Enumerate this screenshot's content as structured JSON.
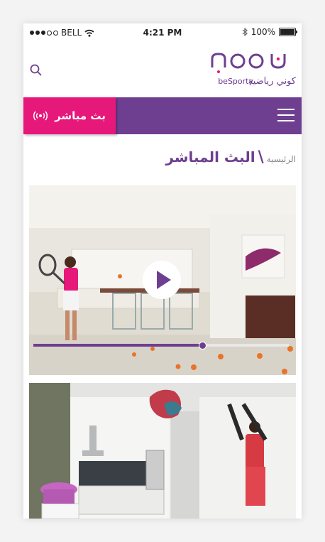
{
  "status_bar": {
    "carrier": "BELL",
    "time": "4:21 PM",
    "battery": "100%",
    "battery_level": 1.0,
    "signal_bars_filled": 3,
    "signal_bars_total": 5
  },
  "header": {
    "logo_text_ar": "كوني رياضية",
    "logo_text_en": "beSporty"
  },
  "navbar": {
    "live_label": "بث مباشر",
    "colors": {
      "primary": "#6e3f91",
      "accent": "#e6197a"
    }
  },
  "breadcrumb": {
    "home": "الرئيسية",
    "separator": "\\",
    "current": "البث المباشر"
  },
  "videos": [
    {
      "progress": 0.66,
      "icons": [
        "play-icon"
      ]
    },
    {
      "icons": []
    }
  ]
}
